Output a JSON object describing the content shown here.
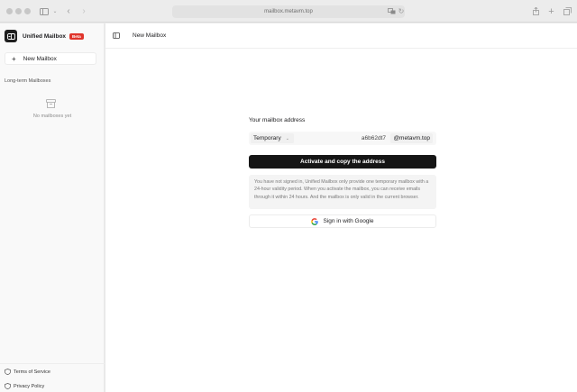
{
  "browser": {
    "url": "mailbox.metavm.top"
  },
  "sidebar": {
    "brand_name": "Unified Mailbox",
    "beta_badge": "Beta",
    "new_mailbox_label": "New Mailbox",
    "section_label": "Long-term Mailboxes",
    "empty_text": "No mailboxes yet",
    "footer": {
      "terms_label": "Terms of Service",
      "privacy_label": "Privacy Policy"
    }
  },
  "main": {
    "page_title": "New Mailbox",
    "panel": {
      "label": "Your mailbox address",
      "type_selected": "Temporary",
      "local_part": "a6b62dt7",
      "domain": "@metavm.top",
      "activate_label": "Activate and copy the address",
      "notice": "You have not signed in, Unified Mailbox only provide one temporary mailbox with a 24-hour validity period. When you activate the mailbox, you can receive emails through it within 24 hours. And the mailbox is only valid in the current browser.",
      "google_label": "Sign in with Google"
    }
  },
  "colors": {
    "accent_dark": "#151515",
    "beta_red": "#e0342b"
  },
  "icons": [
    "traffic-light",
    "sidebar-toggle-icon",
    "back-icon",
    "forward-icon",
    "translate-icon",
    "reload-icon",
    "share-icon",
    "new-tab-icon",
    "tabs-overview-icon",
    "mailbox-logo-icon",
    "plus-icon",
    "archive-icon",
    "shield-icon",
    "google-icon"
  ]
}
